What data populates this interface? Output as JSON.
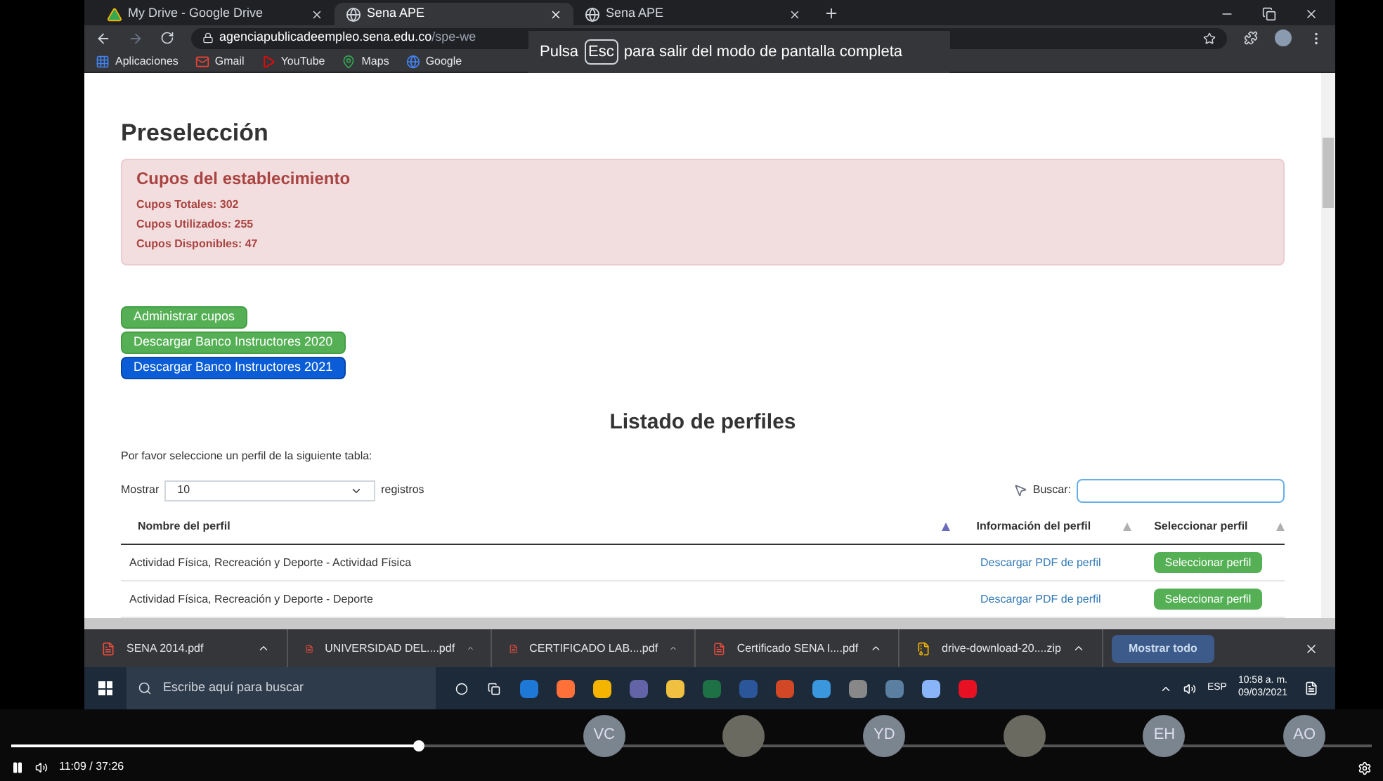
{
  "browser": {
    "tabs": [
      {
        "title": "My Drive - Google Drive",
        "kind": "drive",
        "selected": false
      },
      {
        "title": "Sena APE",
        "kind": "sena",
        "selected": true
      },
      {
        "title": "Sena APE",
        "kind": "sena",
        "selected": false
      }
    ],
    "address": {
      "domain": "agenciapublicadeempleo.sena.edu.co",
      "path": "/spe-we"
    },
    "bookmarks": [
      {
        "label": "Aplicaciones",
        "kind": "apps"
      },
      {
        "label": "Gmail",
        "kind": "gmail"
      },
      {
        "label": "YouTube",
        "kind": "youtube"
      },
      {
        "label": "Maps",
        "kind": "maps"
      },
      {
        "label": "Google",
        "kind": "google"
      }
    ],
    "fullscreen_notice": {
      "before": "Pulsa",
      "key": "Esc",
      "after": "para salir del modo de pantalla completa"
    }
  },
  "page": {
    "title": "Preselección",
    "alert": {
      "title": "Cupos del establecimiento",
      "lines": [
        "Cupos Totales: 302",
        "Cupos Utilizados: 255",
        "Cupos Disponibles: 47"
      ]
    },
    "buttons": [
      {
        "label": "Administrar cupos",
        "kind": "success"
      },
      {
        "label": "Descargar Banco Instructores 2020",
        "kind": "success"
      },
      {
        "label": "Descargar Banco Instructores 2021",
        "kind": "primary"
      }
    ],
    "list_title": "Listado de perfiles",
    "instructions": "Por favor seleccione un perfil de la siguiente tabla:",
    "length": {
      "before": "Mostrar",
      "value": "10",
      "after": "registros"
    },
    "search": {
      "label": "Buscar:"
    },
    "table": {
      "columns": [
        "Nombre del perfil",
        "Información del perfil",
        "Seleccionar perfil"
      ],
      "rows": [
        {
          "name": "Actividad Física, Recreación y Deporte - Actividad Física",
          "link": "Descargar PDF de perfil",
          "action": "Seleccionar perfil"
        },
        {
          "name": "Actividad Física, Recreación y Deporte - Deporte",
          "link": "Descargar PDF de perfil",
          "action": "Seleccionar perfil"
        }
      ]
    }
  },
  "downloads": {
    "items": [
      {
        "name": "SENA 2014.pdf",
        "kind": "pdf"
      },
      {
        "name": "UNIVERSIDAD DEL....pdf",
        "kind": "pdf"
      },
      {
        "name": "CERTIFICADO LAB....pdf",
        "kind": "pdf"
      },
      {
        "name": "Certificado SENA I....pdf",
        "kind": "pdf"
      },
      {
        "name": "drive-download-20....zip",
        "kind": "zip"
      }
    ],
    "show_all": "Mostrar todo"
  },
  "taskbar": {
    "search_placeholder": "Escribe aquí para buscar",
    "language": "ESP",
    "time": "10:58 a. m.",
    "date": "09/03/2021"
  },
  "video": {
    "level": 0.3,
    "time": "11:09 / 37:26",
    "participants": [
      {
        "kind": "initials",
        "initials": "VC"
      },
      {
        "kind": "photo"
      },
      {
        "kind": "initials",
        "initials": "YD"
      },
      {
        "kind": "photo"
      },
      {
        "kind": "initials",
        "initials": "EH"
      },
      {
        "kind": "initials",
        "initials": "AO"
      }
    ]
  }
}
